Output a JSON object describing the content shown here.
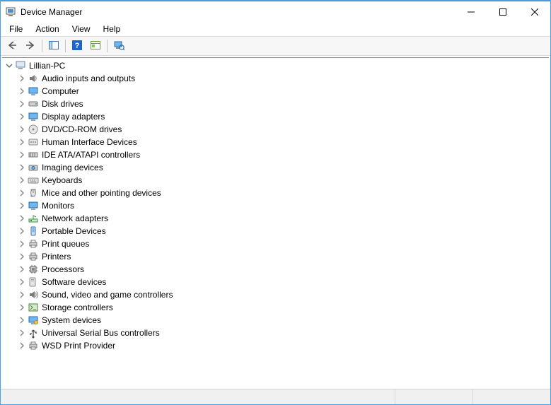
{
  "window": {
    "title": "Device Manager"
  },
  "menu": {
    "file": "File",
    "action": "Action",
    "view": "View",
    "help": "Help"
  },
  "tree": {
    "root": {
      "label": "Lillian-PC",
      "icon": "computer-icon",
      "expanded": true
    },
    "children": [
      {
        "label": "Audio inputs and outputs",
        "icon": "audio-icon"
      },
      {
        "label": "Computer",
        "icon": "monitor-icon"
      },
      {
        "label": "Disk drives",
        "icon": "disk-icon"
      },
      {
        "label": "Display adapters",
        "icon": "monitor-icon"
      },
      {
        "label": "DVD/CD-ROM drives",
        "icon": "optical-icon"
      },
      {
        "label": "Human Interface Devices",
        "icon": "hid-icon"
      },
      {
        "label": "IDE ATA/ATAPI controllers",
        "icon": "ide-icon"
      },
      {
        "label": "Imaging devices",
        "icon": "imaging-icon"
      },
      {
        "label": "Keyboards",
        "icon": "keyboard-icon"
      },
      {
        "label": "Mice and other pointing devices",
        "icon": "mouse-icon"
      },
      {
        "label": "Monitors",
        "icon": "monitor-icon"
      },
      {
        "label": "Network adapters",
        "icon": "network-icon"
      },
      {
        "label": "Portable Devices",
        "icon": "portable-icon"
      },
      {
        "label": "Print queues",
        "icon": "printer-icon"
      },
      {
        "label": "Printers",
        "icon": "printer-icon"
      },
      {
        "label": "Processors",
        "icon": "cpu-icon"
      },
      {
        "label": "Software devices",
        "icon": "software-icon"
      },
      {
        "label": "Sound, video and game controllers",
        "icon": "sound-icon"
      },
      {
        "label": "Storage controllers",
        "icon": "storage-icon"
      },
      {
        "label": "System devices",
        "icon": "system-icon"
      },
      {
        "label": "Universal Serial Bus controllers",
        "icon": "usb-icon"
      },
      {
        "label": "WSD Print Provider",
        "icon": "printer-icon"
      }
    ]
  }
}
